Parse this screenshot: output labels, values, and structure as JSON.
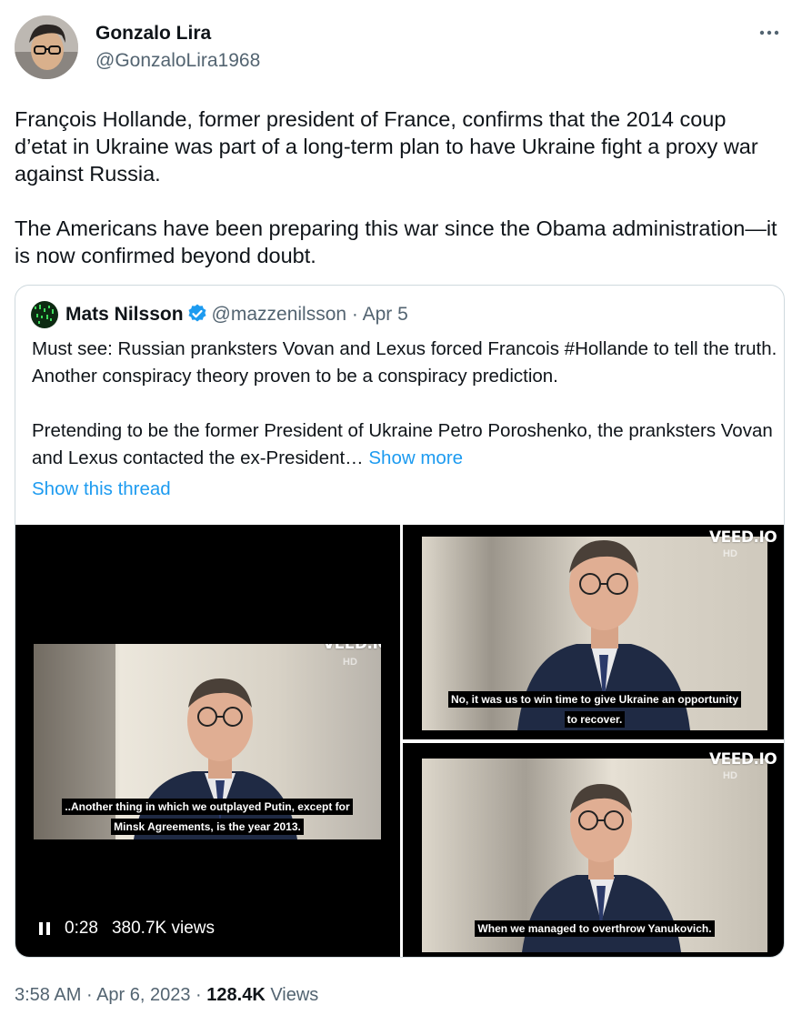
{
  "author": {
    "name": "Gonzalo Lira",
    "handle": "@GonzaloLira1968",
    "avatar_icon": "profile-photo"
  },
  "tweet": {
    "text": "François Hollande, former president of France, confirms that the 2014 coup d’etat in Ukraine was part of a long-term plan to have Ukraine fight a proxy war against Russia.\n\nThe Americans have been preparing this war since the Obama administration—it is now confirmed beyond doubt."
  },
  "quoted": {
    "name": "Mats Nilsson",
    "handle": "@mazzenilsson",
    "separator": "·",
    "date": "Apr 5",
    "text": "Must see: Russian pranksters Vovan and Lexus forced Francois #Hollande to tell the truth. Another conspiracy theory proven to be a conspiracy prediction.\n\nPretending to be the former President of Ukraine Petro Poroshenko, the pranksters Vovan and Lexus contacted the ex-President… ",
    "show_more": "Show more",
    "show_thread": "Show this thread",
    "media": {
      "main": {
        "watermark": "VEED.IO",
        "channel": "HD",
        "caption_line1": "..Another thing in which we outplayed Putin, except for",
        "caption_line2": "Minsk Agreements, is the year 2013.",
        "time": "0:28",
        "views": "380.7K views"
      },
      "top_right": {
        "watermark": "VEED.IO",
        "channel": "HD",
        "caption_line1": "No, it was us to win time to give Ukraine an opportunity",
        "caption_line2": "to recover."
      },
      "bottom_right": {
        "watermark": "VEED.IO",
        "channel": "HD",
        "caption_line1": "When we managed to overthrow Yanukovich."
      }
    }
  },
  "footer": {
    "time": "3:58 AM",
    "sep1": " · ",
    "date": "Apr 6, 2023",
    "sep2": " · ",
    "views_count": "128.4K",
    "views_label": " Views"
  },
  "colors": {
    "link": "#1d9bf0",
    "secondary_text": "#536471",
    "border": "#cfd9de",
    "verified": "#1d9bf0"
  }
}
